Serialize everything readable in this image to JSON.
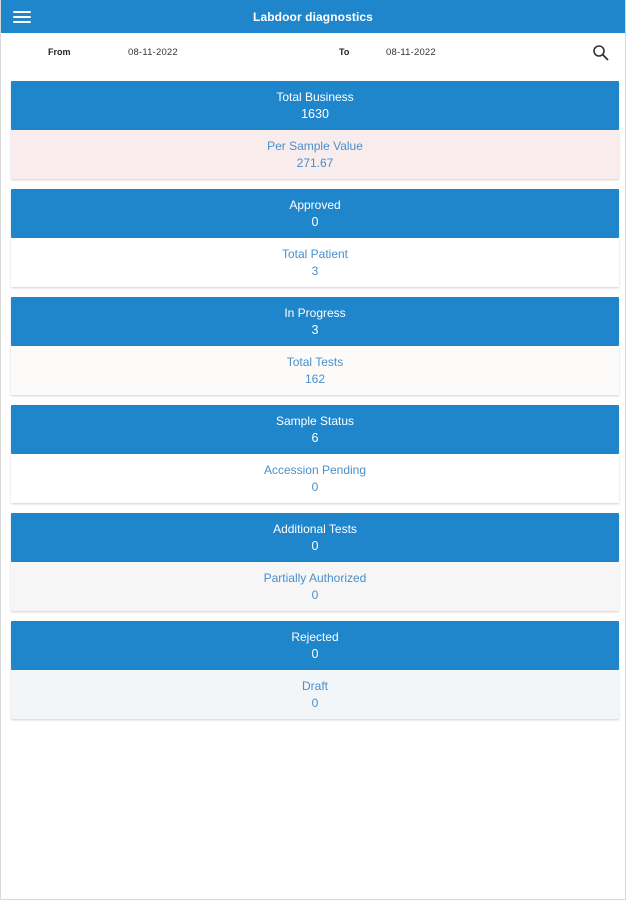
{
  "header": {
    "title": "Labdoor diagnostics",
    "menu_icon": "hamburger-menu-icon"
  },
  "filter": {
    "from_label": "From",
    "from_date": "08-11-2022",
    "to_label": "To",
    "to_date": "08-11-2022",
    "search_icon": "search-icon"
  },
  "colors": {
    "accent": "#1f86cc",
    "secondary_text": "#4a8fca"
  },
  "cards": [
    {
      "primary": {
        "title": "Total Business",
        "value": "1630"
      },
      "secondary": {
        "title": "Per Sample Value",
        "value": "271.67"
      }
    },
    {
      "primary": {
        "title": "Approved",
        "value": "0"
      },
      "secondary": {
        "title": "Total Patient",
        "value": "3"
      }
    },
    {
      "primary": {
        "title": "In Progress",
        "value": "3"
      },
      "secondary": {
        "title": "Total Tests",
        "value": "162"
      }
    },
    {
      "primary": {
        "title": "Sample Status",
        "value": "6"
      },
      "secondary": {
        "title": "Accession Pending",
        "value": "0"
      }
    },
    {
      "primary": {
        "title": "Additional Tests",
        "value": "0"
      },
      "secondary": {
        "title": "Partially Authorized",
        "value": "0"
      }
    },
    {
      "primary": {
        "title": "Rejected",
        "value": "0"
      },
      "secondary": {
        "title": "Draft",
        "value": "0"
      }
    }
  ]
}
